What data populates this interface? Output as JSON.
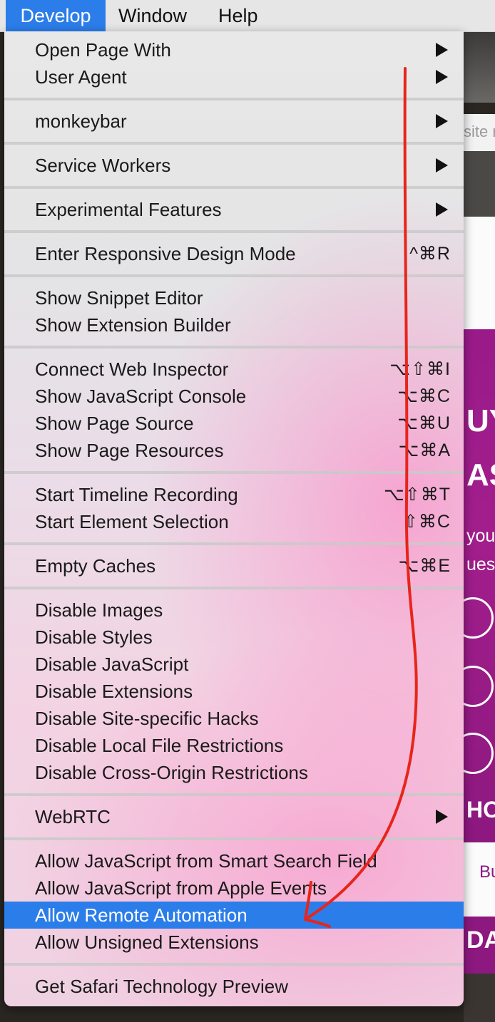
{
  "menubar": {
    "items": [
      {
        "label": "Develop",
        "active": true
      },
      {
        "label": "Window",
        "active": false
      },
      {
        "label": "Help",
        "active": false
      }
    ]
  },
  "menu": {
    "items": [
      {
        "label": "Open Page With",
        "submenu": true
      },
      {
        "label": "User Agent",
        "submenu": true
      },
      {
        "label": "monkeybar",
        "submenu": true
      },
      {
        "label": "Service Workers",
        "submenu": true
      },
      {
        "label": "Experimental Features",
        "submenu": true
      },
      {
        "label": "Enter Responsive Design Mode",
        "shortcut": "^⌘R"
      },
      {
        "label": "Show Snippet Editor"
      },
      {
        "label": "Show Extension Builder"
      },
      {
        "label": "Connect Web Inspector",
        "shortcut": "⌥⇧⌘I"
      },
      {
        "label": "Show JavaScript Console",
        "shortcut": "⌥⌘C"
      },
      {
        "label": "Show Page Source",
        "shortcut": "⌥⌘U"
      },
      {
        "label": "Show Page Resources",
        "shortcut": "⌥⌘A"
      },
      {
        "label": "Start Timeline Recording",
        "shortcut": "⌥⇧⌘T"
      },
      {
        "label": "Start Element Selection",
        "shortcut": "⇧⌘C"
      },
      {
        "label": "Empty Caches",
        "shortcut": "⌥⌘E"
      },
      {
        "label": "Disable Images"
      },
      {
        "label": "Disable Styles"
      },
      {
        "label": "Disable JavaScript"
      },
      {
        "label": "Disable Extensions"
      },
      {
        "label": "Disable Site-specific Hacks"
      },
      {
        "label": "Disable Local File Restrictions"
      },
      {
        "label": "Disable Cross-Origin Restrictions"
      },
      {
        "label": "WebRTC",
        "submenu": true
      },
      {
        "label": "Allow JavaScript from Smart Search Field"
      },
      {
        "label": "Allow JavaScript from Apple Events"
      },
      {
        "label": "Allow Remote Automation",
        "highlighted": true
      },
      {
        "label": "Allow Unsigned Extensions"
      },
      {
        "label": "Get Safari Technology Preview"
      }
    ]
  },
  "background": {
    "address_fragment": "site r",
    "headline_1": "UY",
    "headline_2": "AS",
    "text_1": "you'",
    "text_2": "uest",
    "text_3": "HO",
    "text_4": "Bu",
    "text_5": "DA"
  },
  "colors": {
    "highlight": "#2b7de9",
    "annotation_arrow": "#e8251a"
  }
}
